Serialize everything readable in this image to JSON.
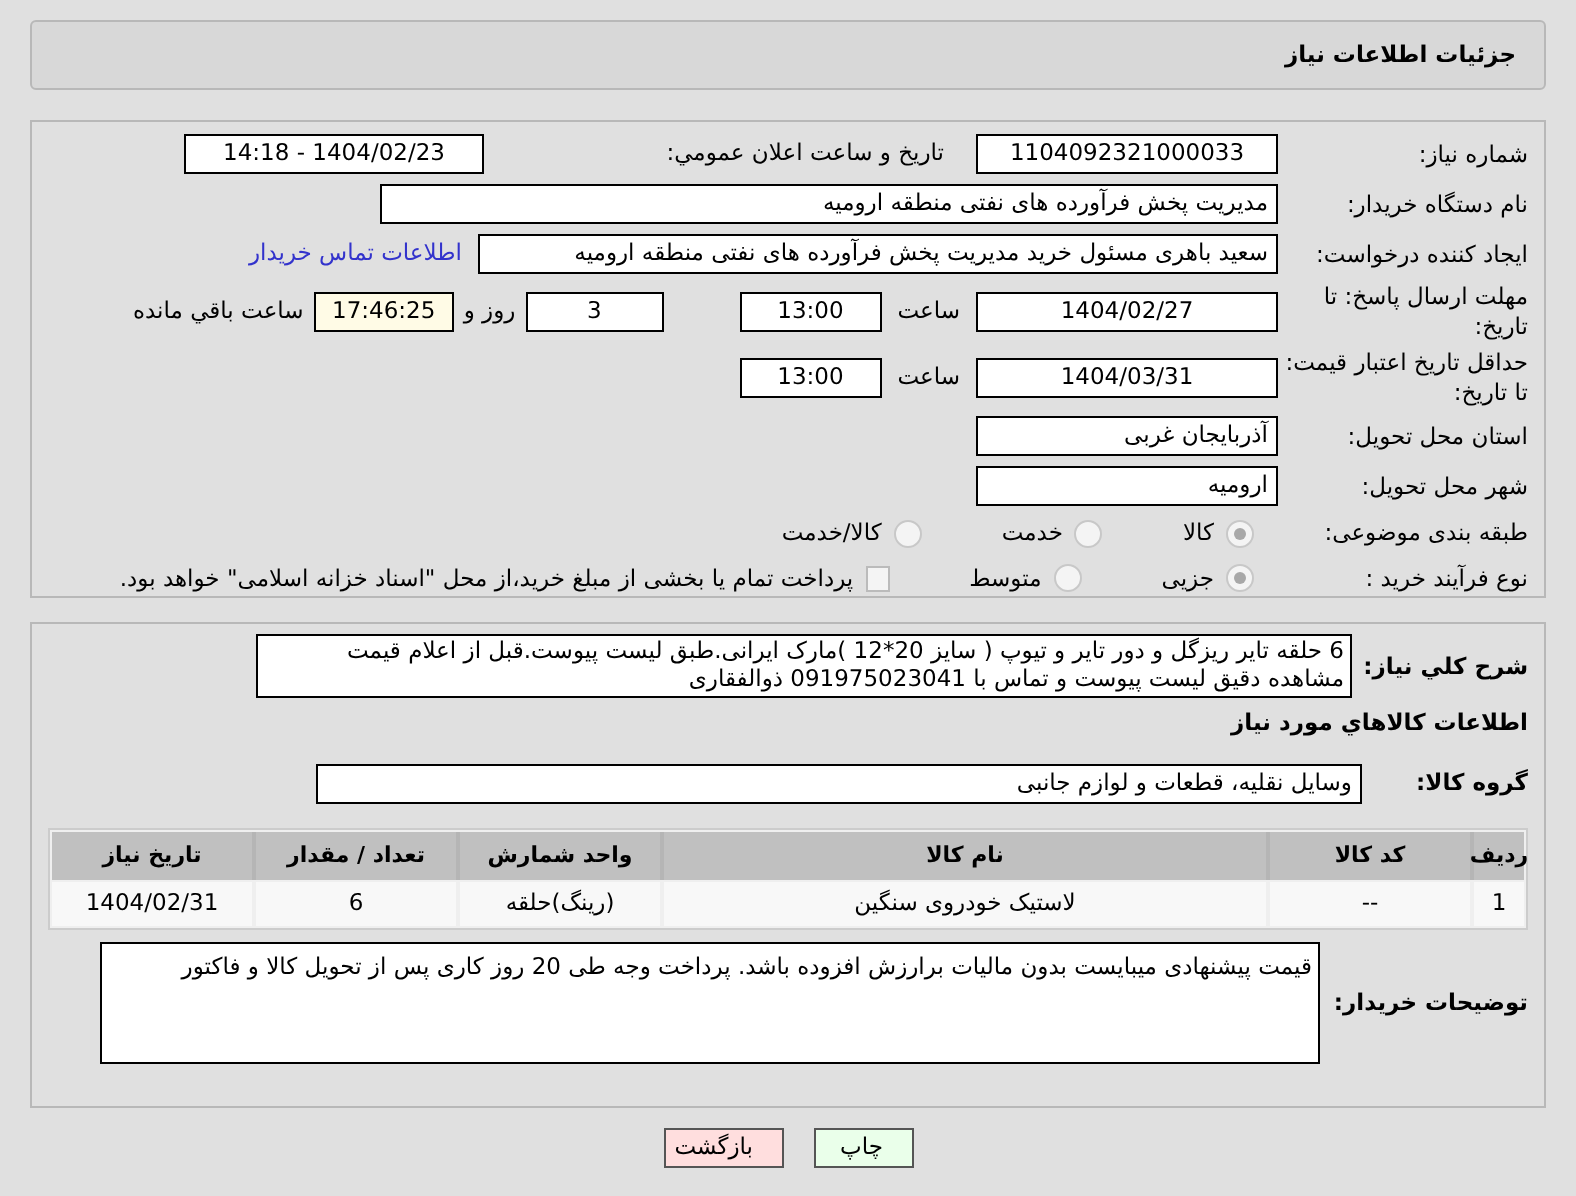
{
  "header": {
    "title": "جزئیات اطلاعات نیاز"
  },
  "details": {
    "need_number": {
      "label": "شماره نیاز:",
      "value": "1104092321000033"
    },
    "announce": {
      "label": "تاریخ و ساعت اعلان عمومي:",
      "value": "1404/02/23 - 14:18"
    },
    "buyer": {
      "label": "نام دستگاه خریدار:",
      "value": "مدیریت پخش فرآورده های نفتی منطقه ارومیه"
    },
    "creator": {
      "label": "ایجاد کننده درخواست:",
      "value": "سعید باهری مسئول خرید مدیریت پخش فرآورده های نفتی منطقه ارومیه",
      "link": "اطلاعات تماس خریدار"
    },
    "deadline": {
      "label": "مهلت ارسال پاسخ: تا تاریخ:",
      "date": "1404/02/27",
      "time_label": "ساعت",
      "time": "13:00",
      "days": "3",
      "days_label": "روز و",
      "remaining": "17:46:25",
      "remaining_label": "ساعت باقي مانده"
    },
    "validity": {
      "label": "حداقل تاریخ اعتبار قیمت: تا تاریخ:",
      "date": "1404/03/31",
      "time_label": "ساعت",
      "time": "13:00"
    },
    "province": {
      "label": "استان محل تحویل:",
      "value": "آذربایجان غربی"
    },
    "city": {
      "label": "شهر محل تحویل:",
      "value": "ارومیه"
    },
    "category": {
      "label": "طبقه بندی موضوعی:",
      "options": [
        {
          "label": "کالا",
          "selected": true
        },
        {
          "label": "خدمت",
          "selected": false
        },
        {
          "label": "کالا/خدمت",
          "selected": false
        }
      ]
    },
    "process": {
      "label": "نوع فرآیند خرید :",
      "options": [
        {
          "label": "جزیی",
          "selected": true
        },
        {
          "label": "متوسط",
          "selected": false
        }
      ],
      "treasury": {
        "label": "پرداخت تمام یا بخشی از مبلغ خرید،از محل \"اسناد خزانه اسلامی\" خواهد بود.",
        "checked": false
      }
    }
  },
  "need": {
    "label": "شرح کلي نیاز:",
    "lines": [
      "6 حلقه تایر ریزگل و دور تایر و تیوپ ( سایز 20*12 )مارک ایرانی.طبق لیست پیوست.قبل از اعلام قیمت",
      "مشاهده دقیق لیست پیوست و تماس با 091975023041 ذوالفقاری"
    ]
  },
  "goods_title": "اطلاعات کالاهاي مورد نياز",
  "group": {
    "label": "گروه کالا:",
    "value": "وسایل نقلیه، قطعات و لوازم جانبی"
  },
  "table": {
    "columns": [
      "ردیف",
      "کد کالا",
      "نام کالا",
      "واحد شمارش",
      "تعداد / مقدار",
      "تاریخ نیاز"
    ],
    "rows": [
      [
        "1",
        "--",
        "لاستیک خودروی سنگین",
        "(رینگ)حلقه",
        "6",
        "1404/02/31"
      ]
    ]
  },
  "notes": {
    "label": "توضیحات خریدار:",
    "value": "قیمت پیشنهادی میبایست بدون مالیات برارزش افزوده باشد. پرداخت وجه طی 20 روز کاری پس از تحویل کالا و فاکتور"
  },
  "buttons": [
    {
      "label": "چاپ",
      "kind": "print"
    },
    {
      "label": "بازگشت",
      "kind": "back"
    }
  ]
}
